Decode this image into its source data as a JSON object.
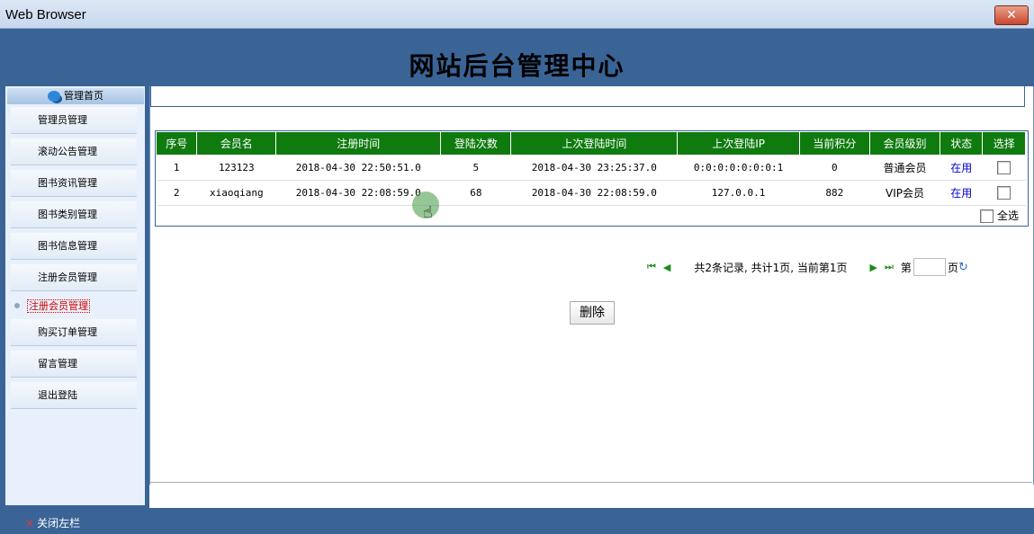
{
  "window": {
    "title": "Web Browser",
    "close_label": "✕"
  },
  "header": {
    "title": "网站后台管理中心"
  },
  "sidebar": {
    "home_label": "管理首页",
    "items": [
      {
        "label": "管理员管理"
      },
      {
        "label": "滚动公告管理"
      },
      {
        "label": "图书资讯管理"
      },
      {
        "label": "图书类别管理"
      },
      {
        "label": "图书信息管理"
      },
      {
        "label": "注册会员管理"
      },
      {
        "label": "注册会员管理",
        "active": true
      },
      {
        "label": "购买订单管理"
      },
      {
        "label": "留言管理"
      },
      {
        "label": "退出登陆"
      }
    ]
  },
  "table": {
    "headers": [
      "序号",
      "会员名",
      "注册时间",
      "登陆次数",
      "上次登陆时间",
      "上次登陆IP",
      "当前积分",
      "会员级别",
      "状态",
      "选择"
    ],
    "rows": [
      [
        "1",
        "123123",
        "2018-04-30 22:50:51.0",
        "5",
        "2018-04-30 23:25:37.0",
        "0:0:0:0:0:0:0:1",
        "0",
        "普通会员",
        "在用"
      ],
      [
        "2",
        "xiaoqiang",
        "2018-04-30 22:08:59.0",
        "68",
        "2018-04-30 22:08:59.0",
        "127.0.0.1",
        "882",
        "VIP会员",
        "在用"
      ]
    ],
    "select_all_label": "全选"
  },
  "pager": {
    "first": "⏮",
    "prev": "◀",
    "info": "共2条记录, 共计1页, 当前第1页",
    "next": "▶",
    "last": "⏭",
    "goto_prefix": "第",
    "goto_suffix": "页",
    "page_value": ""
  },
  "actions": {
    "delete_label": "删除"
  },
  "footer": {
    "close_left_label": "关闭左栏",
    "close_icon": "×"
  }
}
